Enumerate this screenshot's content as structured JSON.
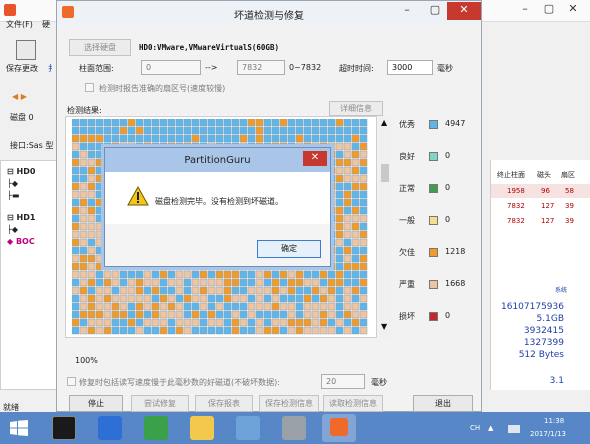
{
  "background_app": {
    "menu": [
      "文件(F)",
      "硬"
    ],
    "toolbar_save": "保存更改",
    "toolbar_save_trail": "扌",
    "nav_arrows": "◀ ▶",
    "disk_line": "磁盘 0",
    "iface_line": "接口:Sas 型",
    "tree": [
      "HD0",
      "HD1",
      "BOC"
    ],
    "table_headers": [
      "终止柱面",
      "磁头",
      "扇区"
    ],
    "table_rows": [
      [
        "1958",
        "96",
        "58"
      ],
      [
        "7832",
        "127",
        "39"
      ],
      [
        "7832",
        "127",
        "39"
      ]
    ],
    "sys_label": "系统",
    "stats": [
      "16107175936",
      "5.1GB",
      "3932415",
      "1327399",
      "512 Bytes"
    ],
    "stat_extra": "3.1",
    "status_text": "就绪"
  },
  "dialog": {
    "title": "坏道检测与修复",
    "select_disk_button": "选择硬盘",
    "disk_name": "HD0:VMware,VMwareVirtualS(60GB)",
    "cylinder_label": "柱面范围:",
    "cylinder_from": "0",
    "cylinder_arrow": "-->",
    "cylinder_to": "7832",
    "cylinder_range": "0~7832",
    "timeout_label": "超时时间:",
    "timeout_value": "3000",
    "timeout_unit": "毫秒",
    "report_sector_label": "检测时报告准确的扇区号(速度较慢)",
    "results_label": "检测结果:",
    "details_button": "详细信息",
    "progress": "100%",
    "repair_label": "修复时包括读写速度慢于此毫秒数的好磁道(不破坏数据):",
    "repair_value": "20",
    "repair_unit": "毫秒",
    "buttons": {
      "stop": "停止",
      "try_repair": "尝试修复",
      "save_report": "保存报表",
      "save_info": "保存检测信息",
      "read_info": "读取检测信息",
      "exit": "退出"
    }
  },
  "legend": [
    {
      "label": "优秀",
      "count": "4947",
      "color": "#5fb4e8"
    },
    {
      "label": "良好",
      "count": "0",
      "color": "#7fd6c8"
    },
    {
      "label": "正常",
      "count": "0",
      "color": "#3f9f4f"
    },
    {
      "label": "一般",
      "count": "0",
      "color": "#f4e08c"
    },
    {
      "label": "欠佳",
      "count": "1218",
      "color": "#f09a2a"
    },
    {
      "label": "严重",
      "count": "1668",
      "color": "#eec5a2"
    },
    {
      "label": "损坏",
      "count": "0",
      "color": "#c4262e"
    }
  ],
  "popup": {
    "title": "PartitionGuru",
    "message": "磁盘检测完毕。没有检测到坏磁道。",
    "ok_button": "确定"
  },
  "taskbar": {
    "ime": "CH",
    "time": "11:38",
    "date": "2017/1/13"
  }
}
